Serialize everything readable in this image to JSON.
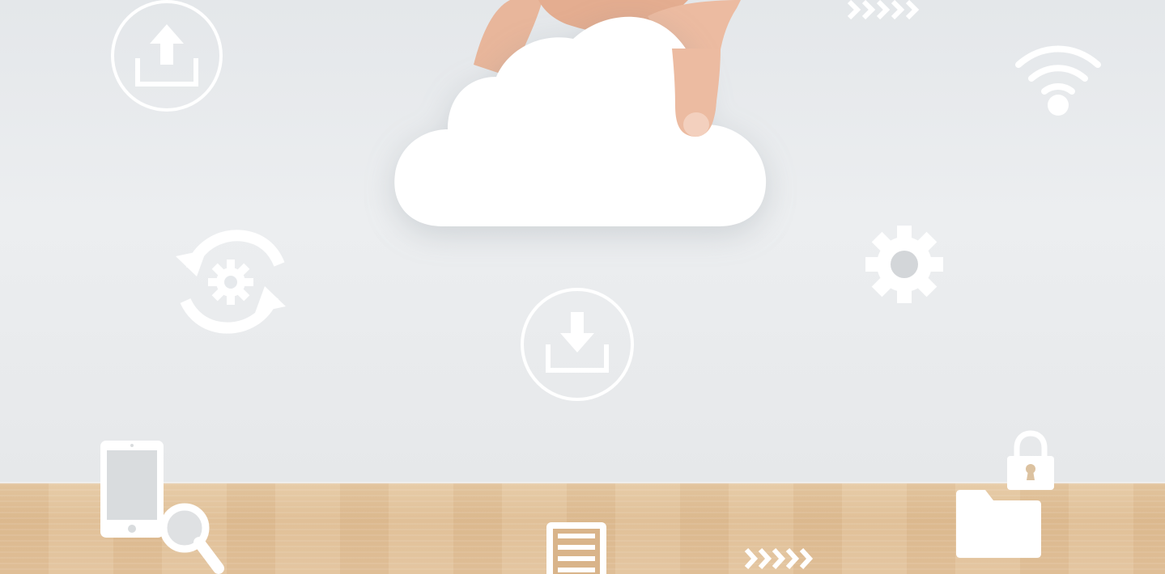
{
  "scene": {
    "description_tags": [
      "cloud-computing",
      "hand",
      "icons"
    ],
    "colors": {
      "wall": "#e6e9ec",
      "table": "#e2c39c",
      "icon": "#ffffff",
      "skin": "#e9b79c"
    }
  },
  "icons": {
    "upload": "upload-icon",
    "download": "download-icon",
    "wifi": "wifi-icon",
    "gear": "gear-icon",
    "sync_gear": "sync-gear-icon",
    "phone_search": "phone-search-icon",
    "document": "document-icon",
    "lock": "lock-icon",
    "folder": "folder-icon",
    "chevrons": "chevrons-icon",
    "cloud": "cloud-icon"
  }
}
